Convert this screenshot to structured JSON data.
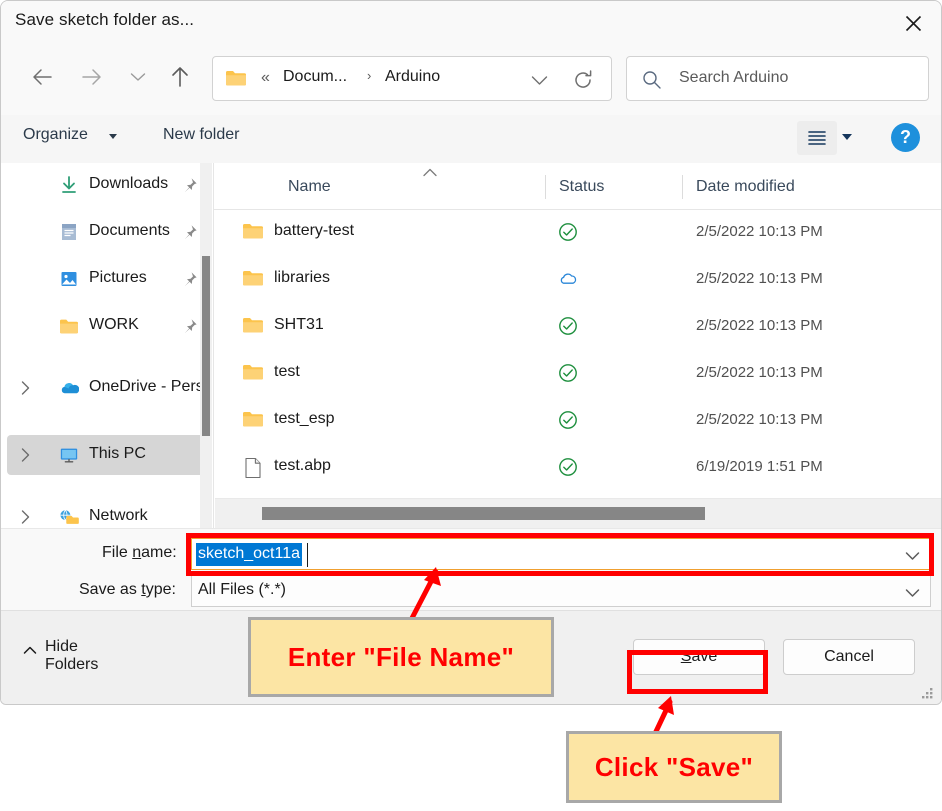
{
  "window": {
    "title": "Save sketch folder as...",
    "close_label": "Close"
  },
  "nav": {
    "back_label": "Back",
    "forward_label": "Forward",
    "recent_label": "Recent locations",
    "up_label": "Up",
    "refresh_label": "Refresh",
    "breadcrumb_overflow": "«",
    "breadcrumb_sep": "›",
    "breadcrumb": [
      "Docum...",
      "Arduino"
    ]
  },
  "search": {
    "placeholder": "Search Arduino",
    "value": ""
  },
  "commandbar": {
    "organize_label": "Organize",
    "new_folder_label": "New folder",
    "view_label": "View",
    "help_label": "?"
  },
  "sidebar": {
    "items": [
      {
        "label": "Downloads",
        "icon": "download-icon",
        "pinned": true,
        "expandable": false,
        "selected": false
      },
      {
        "label": "Documents",
        "icon": "document-icon",
        "pinned": true,
        "expandable": false,
        "selected": false
      },
      {
        "label": "Pictures",
        "icon": "picture-icon",
        "pinned": true,
        "expandable": false,
        "selected": false
      },
      {
        "label": "WORK",
        "icon": "folder-icon",
        "pinned": true,
        "expandable": false,
        "selected": false
      },
      {
        "label": "OneDrive - Perso",
        "icon": "onedrive-icon",
        "pinned": false,
        "expandable": true,
        "selected": false
      },
      {
        "label": "This PC",
        "icon": "monitor-icon",
        "pinned": false,
        "expandable": true,
        "selected": true
      },
      {
        "label": "Network",
        "icon": "network-icon",
        "pinned": false,
        "expandable": true,
        "selected": false
      }
    ]
  },
  "filelist": {
    "columns": [
      "Name",
      "Status",
      "Date modified"
    ],
    "sorted_by": "Name",
    "sort_direction": "ascending",
    "rows": [
      {
        "name": "battery-test",
        "icon": "folder-icon",
        "status": "synced-check-icon",
        "date": "2/5/2022 10:13 PM"
      },
      {
        "name": "libraries",
        "icon": "folder-icon",
        "status": "cloud-icon",
        "date": "2/5/2022 10:13 PM"
      },
      {
        "name": "SHT31",
        "icon": "folder-icon",
        "status": "synced-check-icon",
        "date": "2/5/2022 10:13 PM"
      },
      {
        "name": "test",
        "icon": "folder-icon",
        "status": "synced-check-icon",
        "date": "2/5/2022 10:13 PM"
      },
      {
        "name": "test_esp",
        "icon": "folder-icon",
        "status": "synced-check-icon",
        "date": "2/5/2022 10:13 PM"
      },
      {
        "name": "test.abp",
        "icon": "file-icon",
        "status": "synced-check-icon",
        "date": "6/19/2019 1:51 PM"
      }
    ]
  },
  "form": {
    "filename_label_pre": "File ",
    "filename_label_accel": "n",
    "filename_label_post": "ame:",
    "filename_value": "sketch_oct11a",
    "savetype_label_pre": "Save as ",
    "savetype_label_accel": "t",
    "savetype_label_post": "ype:",
    "savetype_value": "All Files (*.*)"
  },
  "footer": {
    "hide_folders_label": "Hide Folders",
    "save_label_accel": "S",
    "save_label_post": "ave",
    "cancel_label": "Cancel"
  },
  "annotations": {
    "callout_filename": "Enter \"File Name\"",
    "callout_save": "Click \"Save\""
  },
  "colors": {
    "annotation_red": "#ff0000",
    "callout_bg": "#fce5a4",
    "callout_border": "#a8a8a8",
    "selection_blue": "#0078d4",
    "folder_yellow": "#fcc44c",
    "help_blue": "#1e90dc",
    "sync_green": "#1e8f3e",
    "cloud_blue": "#2986d8",
    "selected_row": "#d6d6d6"
  }
}
